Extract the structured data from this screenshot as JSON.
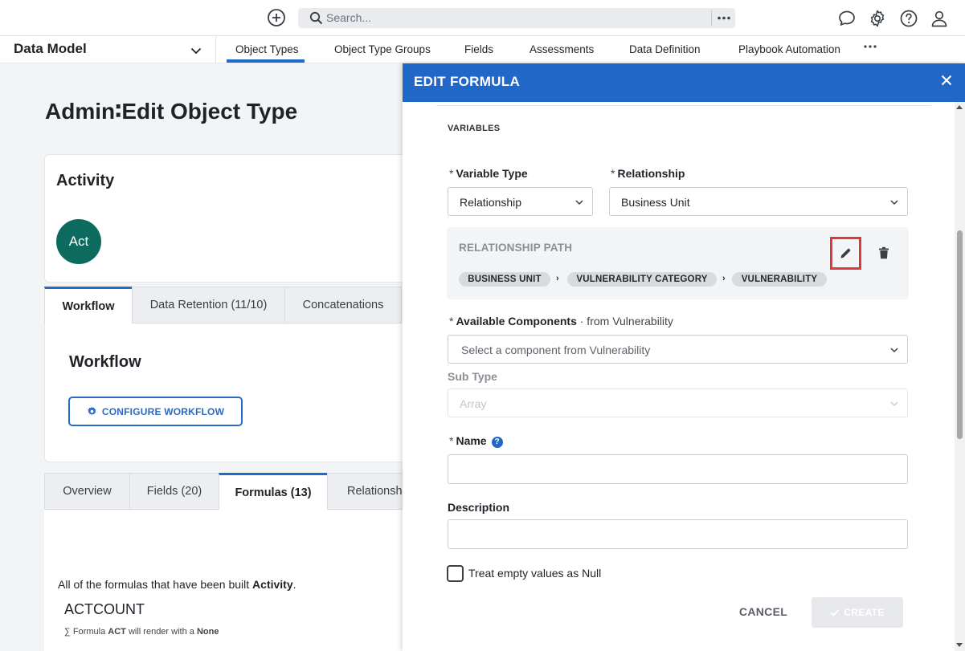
{
  "topbar": {
    "search_placeholder": "Search...",
    "icons": [
      "plus-circle-icon",
      "search-icon",
      "more-icon",
      "chat-icon",
      "gear-icon",
      "help-icon",
      "user-icon"
    ]
  },
  "nav": {
    "module": "Data Model",
    "tabs": [
      {
        "label": "Object Types",
        "active": true
      },
      {
        "label": "Object Type Groups"
      },
      {
        "label": "Fields"
      },
      {
        "label": "Assessments"
      },
      {
        "label": "Data Definition"
      },
      {
        "label": "Playbook Automation"
      }
    ]
  },
  "page": {
    "title": "Admin∶Edit Object Type",
    "card_title": "Activity",
    "avatar_text": "Act",
    "upper_tabs": [
      "Workflow",
      "Data Retention (11/10)",
      "Concatenations"
    ],
    "workflow_title": "Workflow",
    "configure_button": "CONFIGURE WORKFLOW",
    "lower_tabs": [
      "Overview",
      "Fields (20)",
      "Formulas (13)",
      "Relationshi"
    ],
    "formulas_desc_prefix": "All of the formulas that have been built ",
    "formulas_desc_object": "Activity",
    "formulas_desc_suffix": ".",
    "formula_name": "ACTCOUNT",
    "formula_sub_prefix": "∑  Formula ",
    "formula_sub_code": "ACT",
    "formula_sub_mid": " will render with a ",
    "formula_sub_value": "None"
  },
  "drawer": {
    "title": "EDIT FORMULA",
    "section": "VARIABLES",
    "variable_type_label": "Variable Type",
    "variable_type_value": "Relationship",
    "relationship_label": "Relationship",
    "relationship_value": "Business Unit",
    "relationship_path_title": "RELATIONSHIP PATH",
    "path_chips": [
      "BUSINESS UNIT",
      "VULNERABILITY CATEGORY",
      "VULNERABILITY"
    ],
    "path_separator": "›",
    "available_components_label": "Available Components",
    "available_components_from": " · from Vulnerability",
    "available_components_placeholder": "Select a component from Vulnerability",
    "sub_type_label": "Sub Type",
    "sub_type_value": "Array",
    "name_label": "Name",
    "help_glyph": "?",
    "description_label": "Description",
    "checkbox_label": "Treat empty values as Null",
    "cancel_label": "CANCEL",
    "create_label": "CREATE",
    "required_mark": "*"
  }
}
